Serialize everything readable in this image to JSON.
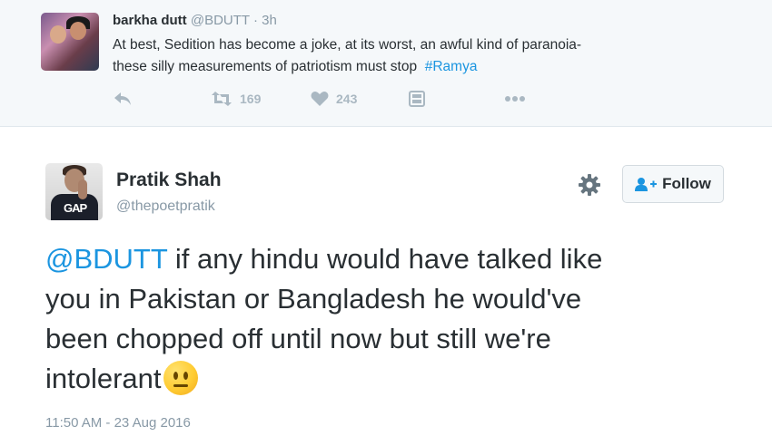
{
  "parent_tweet": {
    "name": "barkha dutt",
    "handle": "@BDUTT",
    "separator": "·",
    "time": "3h",
    "text_line1": "At best, Sedition has become a joke, at its worst, an awful kind of paranoia-",
    "text_line2": "these silly measurements of patriotism must stop",
    "hashtag": "#Ramya",
    "retweets": "169",
    "likes": "243",
    "icons": [
      "reply-icon",
      "retweet-icon",
      "heart-icon",
      "media-icon",
      "more-icon"
    ]
  },
  "main_tweet": {
    "name": "Pratik Shah",
    "handle": "@thepoetpratik",
    "follow_label": "Follow",
    "mention": "@BDUTT",
    "text_line1": " if any hindu would have talked like",
    "text_line2": "you in Pakistan or Bangladesh he would've",
    "text_line3": "been chopped off until now but still we're",
    "text_line4": "intolerant",
    "emoji": "neutral-face",
    "timestamp": "11:50 AM - 23 Aug 2016"
  },
  "colors": {
    "link": "#1b95e0",
    "muted": "#8899a6",
    "icon": "#aab8c2",
    "text": "#292f33",
    "parent_bg": "#f5f8fa"
  }
}
